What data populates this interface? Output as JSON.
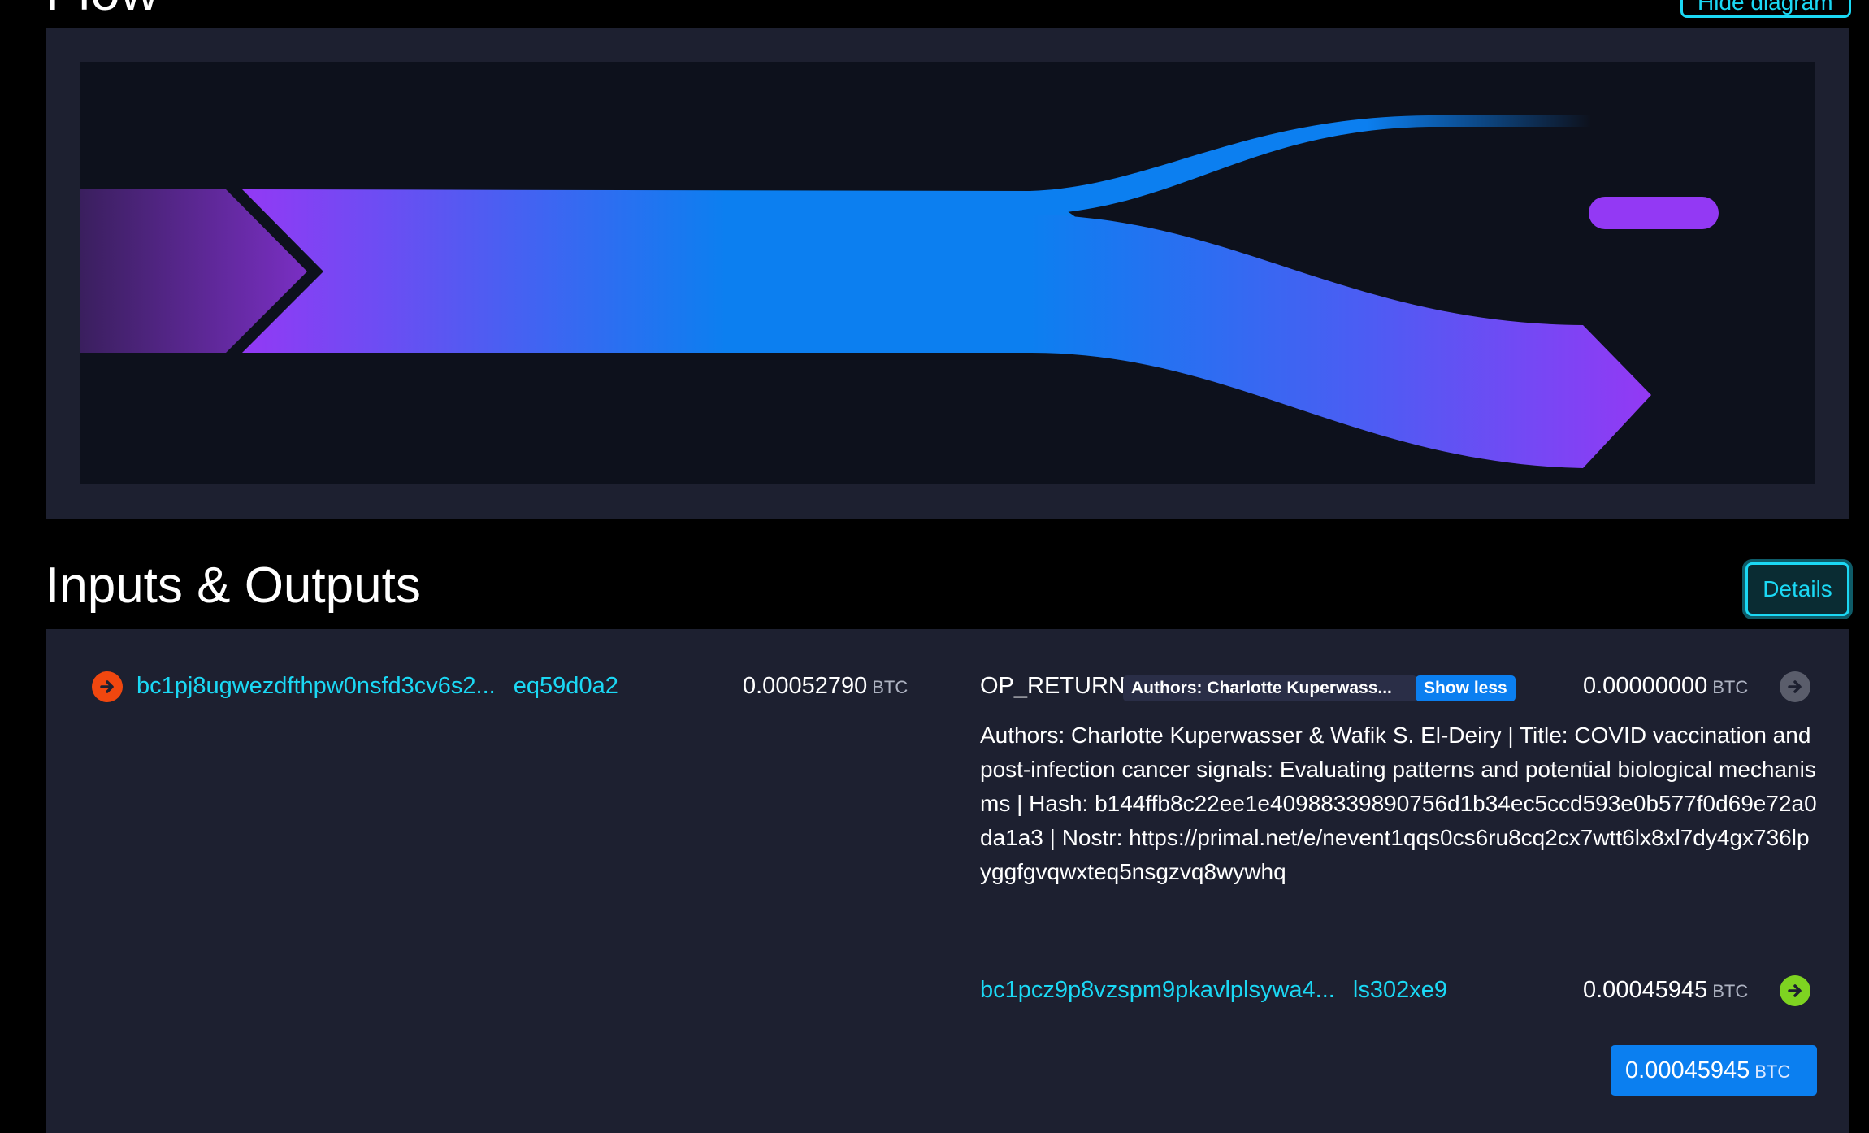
{
  "flow_section": {
    "title": "Flow",
    "hide_button": "Hide diagram"
  },
  "io_section": {
    "title": "Inputs & Outputs",
    "details_button": "Details"
  },
  "inputs": [
    {
      "address_start": "bc1pj8ugwezdfthpw0nsfd3cv6s2...",
      "address_end": "eq59d0a2",
      "amount": "0.00052790",
      "unit": "BTC"
    }
  ],
  "outputs": [
    {
      "label": "OP_RETURN",
      "badge": "Authors: Charlotte Kuperwass...",
      "toggle": "Show less",
      "amount": "0.00000000",
      "unit": "BTC",
      "text": "Authors: Charlotte Kuperwasser & Wafik S. El-Deiry | Title: COVID vaccination and post-infection cancer signals: Evaluating patterns and potential biological mechanisms | Hash: b144ffb8c22ee1e40988339890756d1b34ec5ccd593e0b577f0d69e72a0da1a3 | Nostr: https://primal.net/e/nevent1qqs0cs6ru8cq2cx7wtt6lx8xl7dy4gx736lpyggfgvqwxteq5nsgzvq8wywhq"
    },
    {
      "address_start": "bc1pcz9p8vzspm9pkavlplsywa4...",
      "address_end": "ls302xe9",
      "amount": "0.00045945",
      "unit": "BTC"
    }
  ],
  "total": {
    "amount": "0.00045945",
    "unit": "BTC"
  },
  "colors": {
    "accent_cyan": "#1bd8f4",
    "input_arrow": "#f0470f",
    "unspent_arrow": "#7ed321",
    "op_return_arrow": "#5a5d6b",
    "primary_blue": "#0b7ff0",
    "flow_purple": "#9339f4",
    "flow_blue": "#0c7ff0"
  }
}
